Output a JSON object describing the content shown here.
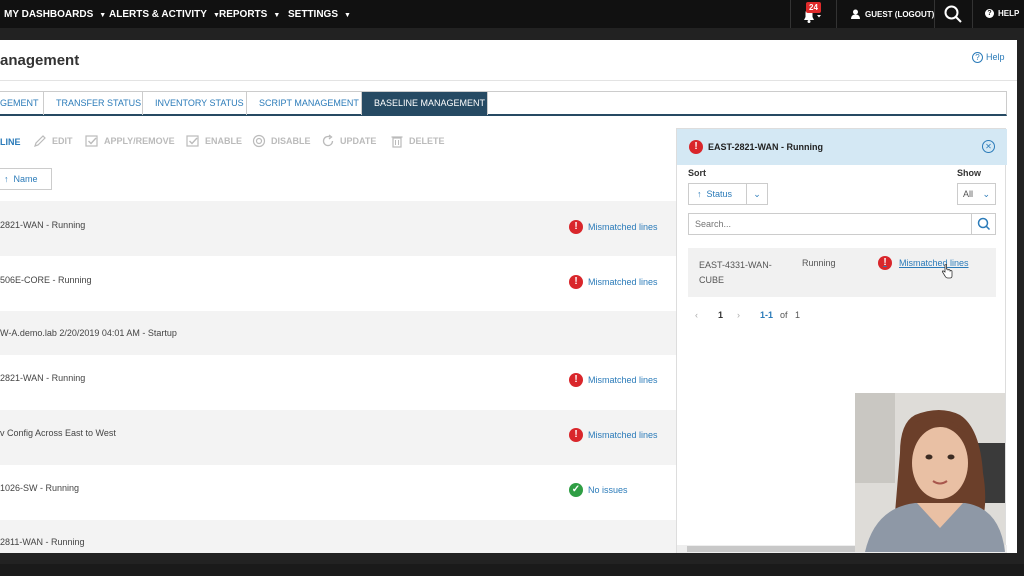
{
  "topnav": {
    "my_dashboards": "MY DASHBOARDS",
    "alerts": "ALERTS & ACTIVITY",
    "reports": "REPORTS",
    "settings": "SETTINGS",
    "notif_count": "24",
    "user": "GUEST (LOGOUT)",
    "help": "HELP"
  },
  "page": {
    "title": "anagement",
    "help": "Help"
  },
  "tabs": [
    "GEMENT",
    "TRANSFER STATUS",
    "INVENTORY STATUS",
    "SCRIPT MANAGEMENT",
    "BASELINE MANAGEMENT"
  ],
  "toolbar": {
    "first": "LINE",
    "edit": "EDIT",
    "apply": "APPLY/REMOVE",
    "enable": "ENABLE",
    "disable": "DISABLE",
    "update": "UPDATE",
    "delete": "DELETE"
  },
  "sort_name": "Name",
  "rows": [
    {
      "name": "2821-WAN - Running",
      "status": "Mismatched lines"
    },
    {
      "name": "506E-CORE - Running",
      "status": "Mismatched lines"
    },
    {
      "name": "W-A.demo.lab 2/20/2019 04:01 AM - Startup",
      "status": ""
    },
    {
      "name": "2821-WAN - Running",
      "status": "Mismatched lines"
    },
    {
      "name": "v Config Across East to West",
      "status": "Mismatched lines"
    },
    {
      "name": "1026-SW - Running",
      "status": "No issues"
    },
    {
      "name": "2811-WAN - Running",
      "status": ""
    }
  ],
  "panel": {
    "title": "EAST-2821-WAN - Running",
    "sort_label": "Sort",
    "sort_value": "Status",
    "show_label": "Show",
    "show_value": "All",
    "search_placeholder": "Search...",
    "result": {
      "name_line1": "EAST-4331-WAN-",
      "name_line2": "CUBE",
      "state": "Running",
      "status": "Mismatched lines"
    },
    "pager": {
      "page": "1",
      "range": "1-1",
      "of": "of",
      "total": "1"
    }
  },
  "colors": {
    "accent": "#2b7bb9",
    "active_tab": "#264a63",
    "error": "#d9262b",
    "ok": "#2f9e44"
  }
}
